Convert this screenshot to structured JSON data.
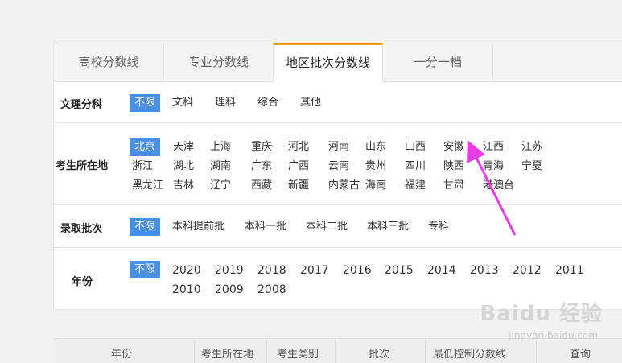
{
  "tabs": [
    "高校分数线",
    "专业分数线",
    "地区批次分数线",
    "一分一档"
  ],
  "subject": {
    "label": "文理分科",
    "options": [
      "不限",
      "文科",
      "理科",
      "综合",
      "其他"
    ]
  },
  "region": {
    "label": "考生所在地",
    "options": [
      "北京",
      "天津",
      "上海",
      "重庆",
      "河北",
      "河南",
      "山东",
      "山西",
      "安徽",
      "江西",
      "江苏",
      "浙江",
      "湖北",
      "湖南",
      "广东",
      "广西",
      "云南",
      "贵州",
      "四川",
      "陕西",
      "青海",
      "宁夏",
      "黑龙江",
      "吉林",
      "辽宁",
      "西藏",
      "新疆",
      "内蒙古",
      "海南",
      "福建",
      "甘肃",
      "港澳台"
    ]
  },
  "batch": {
    "label": "录取批次",
    "options": [
      "不限",
      "本科提前批",
      "本科一批",
      "本科二批",
      "本科三批",
      "专科"
    ]
  },
  "year": {
    "label": "年份",
    "options": [
      "不限",
      "2020",
      "2019",
      "2018",
      "2017",
      "2016",
      "2015",
      "2014",
      "2013",
      "2012",
      "2011",
      "2010",
      "2009",
      "2008"
    ]
  },
  "table_header": [
    "年份",
    "考生所在地",
    "考生类别",
    "批次",
    "最低控制分数线",
    "查询"
  ],
  "watermark": {
    "main": "Baidu 经验",
    "sub": "jingyan.baidu.com"
  },
  "colors": {
    "accent": "#4a90e2",
    "tab_border": "#f39c12",
    "arrow": "#e83ce8"
  }
}
